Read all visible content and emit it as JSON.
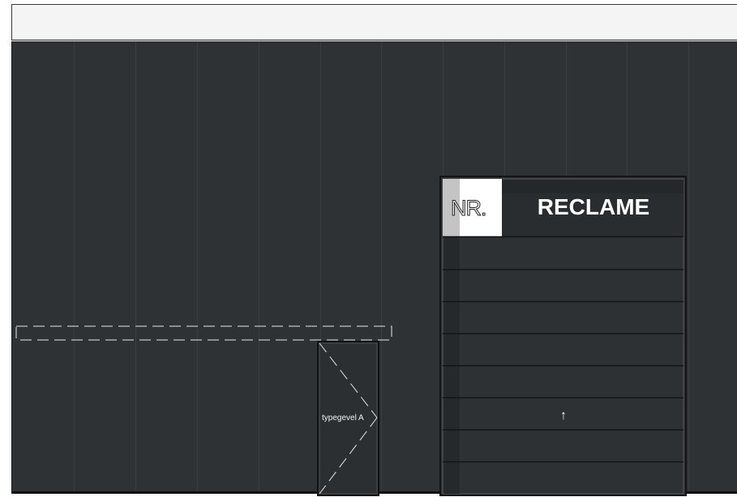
{
  "colors": {
    "facade": "#2f3235",
    "panel_line": "#3a3d40",
    "header_bar": "#f4f4f4",
    "dashed_stroke": "#e8e8e8",
    "sign_white": "#ffffff",
    "sign_grey": "#c4c4c4"
  },
  "door": {
    "label": "typegevel A"
  },
  "sign": {
    "nr_label": "NR.",
    "title": "RECLAME",
    "arrow": "↑",
    "stripe_rows": 8
  },
  "icons": {
    "door_swing": "door-swing-icon",
    "arrow": "arrow-up-icon"
  }
}
